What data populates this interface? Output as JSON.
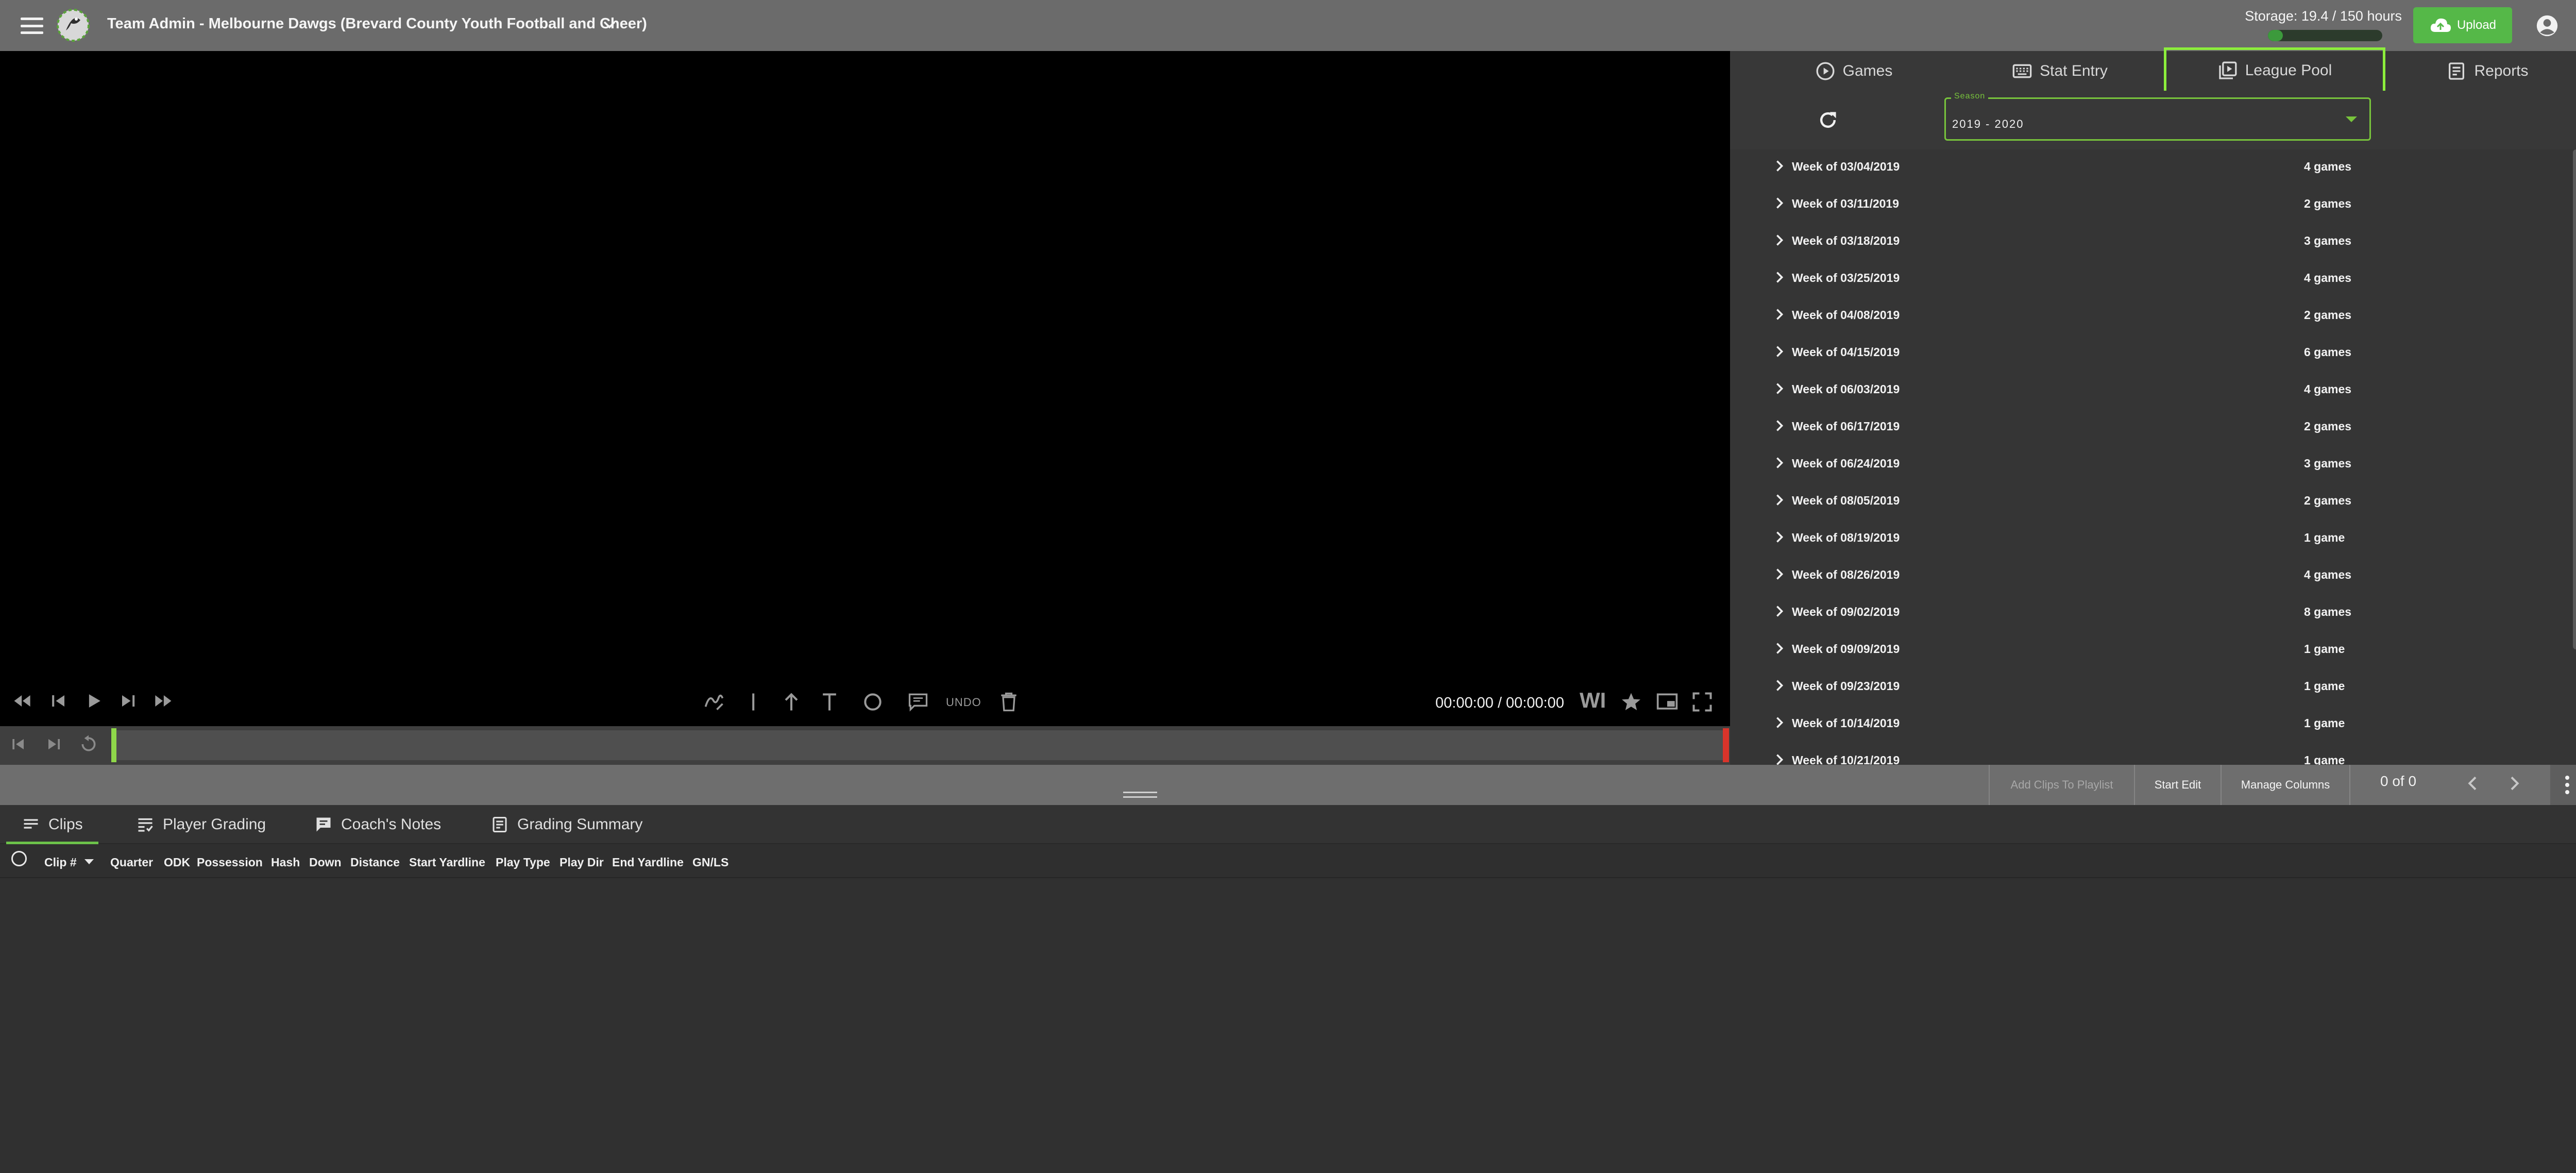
{
  "header": {
    "team_title": "Team Admin - Melbourne Dawgs (Brevard County Youth Football and Cheer)",
    "storage_label": "Storage: 19.4 / 150 hours",
    "storage_used_fraction": 0.13,
    "upload_label": "Upload"
  },
  "player": {
    "timecode": "00:00:00 / 00:00:00",
    "undo_label": "UNDO",
    "wi_label": "WI"
  },
  "right_tabs": [
    {
      "label": "Games",
      "icon": "play-circle-icon"
    },
    {
      "label": "Stat Entry",
      "icon": "keyboard-icon"
    },
    {
      "label": "League Pool",
      "icon": "video-library-icon",
      "active": true
    },
    {
      "label": "Reports",
      "icon": "report-icon"
    }
  ],
  "season": {
    "legend": "Season",
    "value": "2019 - 2020"
  },
  "weeks": [
    {
      "label": "Week of 03/04/2019",
      "count": "4 games"
    },
    {
      "label": "Week of 03/11/2019",
      "count": "2 games"
    },
    {
      "label": "Week of 03/18/2019",
      "count": "3 games"
    },
    {
      "label": "Week of 03/25/2019",
      "count": "4 games"
    },
    {
      "label": "Week of 04/08/2019",
      "count": "2 games"
    },
    {
      "label": "Week of 04/15/2019",
      "count": "6 games"
    },
    {
      "label": "Week of 06/03/2019",
      "count": "4 games"
    },
    {
      "label": "Week of 06/17/2019",
      "count": "2 games"
    },
    {
      "label": "Week of 06/24/2019",
      "count": "3 games"
    },
    {
      "label": "Week of 08/05/2019",
      "count": "2 games"
    },
    {
      "label": "Week of 08/19/2019",
      "count": "1 game"
    },
    {
      "label": "Week of 08/26/2019",
      "count": "4 games"
    },
    {
      "label": "Week of 09/02/2019",
      "count": "8 games"
    },
    {
      "label": "Week of 09/09/2019",
      "count": "1 game"
    },
    {
      "label": "Week of 09/23/2019",
      "count": "1 game"
    },
    {
      "label": "Week of 10/14/2019",
      "count": "1 game"
    },
    {
      "label": "Week of 10/21/2019",
      "count": "1 game"
    }
  ],
  "toolbar": {
    "add_clips_label": "Add Clips To Playlist",
    "start_edit_label": "Start Edit",
    "manage_columns_label": "Manage Columns",
    "pager_text": "0 of 0"
  },
  "bottom_tabs": [
    {
      "label": "Clips",
      "active": true
    },
    {
      "label": "Player Grading"
    },
    {
      "label": "Coach's Notes"
    },
    {
      "label": "Grading Summary"
    }
  ],
  "columns": [
    "Clip #",
    "Quarter",
    "ODK",
    "Possession",
    "Hash",
    "Down",
    "Distance",
    "Start Yardline",
    "Play Type",
    "Play Dir",
    "End Yardline",
    "GN/LS"
  ],
  "colors": {
    "accent_green": "#8cee3c",
    "upload_green": "#55b848",
    "timeline_end_red": "#d9342b"
  }
}
